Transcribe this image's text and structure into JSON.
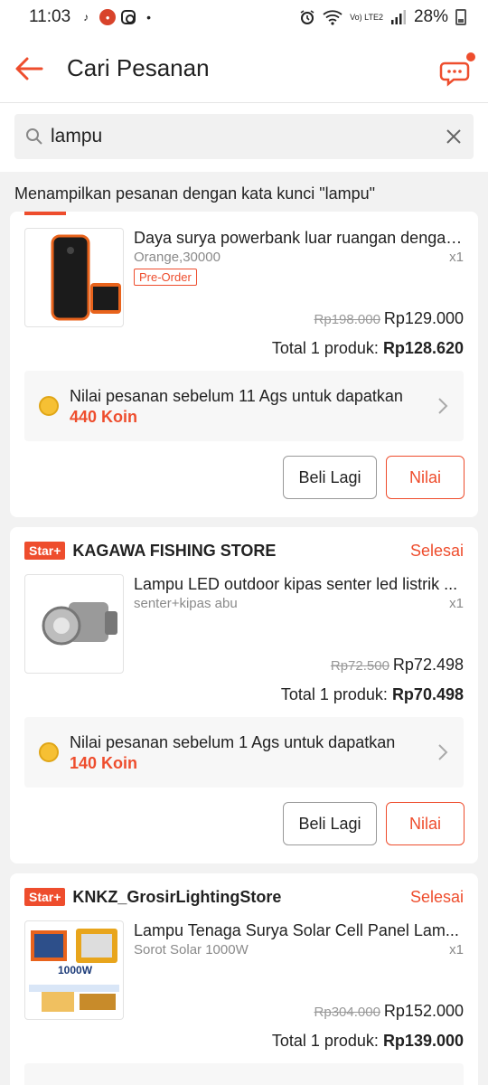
{
  "status_bar": {
    "time": "11:03",
    "battery": "28%",
    "network": "Vo) LTE2"
  },
  "header": {
    "title": "Cari Pesanan"
  },
  "search": {
    "value": "lampu"
  },
  "result_note": "Menampilkan pesanan dengan kata kunci \"lampu\"",
  "orders": [
    {
      "product_name": "Daya surya powerbank luar ruangan dengan...",
      "variation": "Orange,30000",
      "quantity": "x1",
      "tag": "Pre-Order",
      "old_price": "Rp198.000",
      "price": "Rp129.000",
      "total_label": "Total 1 produk:",
      "total_value": "Rp128.620",
      "coin_text": "Nilai pesanan sebelum 11 Ags untuk dapatkan",
      "coin_amount": "440 Koin",
      "buy_again": "Beli Lagi",
      "rate": "Nilai"
    },
    {
      "badge": "Star+",
      "store": "KAGAWA FISHING STORE",
      "status": "Selesai",
      "product_name": "Lampu LED outdoor kipas senter led listrik ...",
      "variation": "senter+kipas abu",
      "quantity": "x1",
      "old_price": "Rp72.500",
      "price": "Rp72.498",
      "total_label": "Total 1 produk:",
      "total_value": "Rp70.498",
      "coin_text": "Nilai pesanan sebelum 1 Ags untuk dapatkan",
      "coin_amount": "140 Koin",
      "buy_again": "Beli Lagi",
      "rate": "Nilai"
    },
    {
      "badge": "Star+",
      "store": "KNKZ_GrosirLightingStore",
      "status": "Selesai",
      "product_name": "Lampu Tenaga Surya Solar Cell Panel Lam...",
      "variation": "Sorot Solar 1000W",
      "quantity": "x1",
      "old_price": "Rp304.000",
      "price": "Rp152.000",
      "total_label": "Total 1 produk:",
      "total_value": "Rp139.000",
      "thumb_text": "1000W"
    }
  ],
  "colors": {
    "accent": "#ee4d2d",
    "coin": "#f6c034"
  }
}
